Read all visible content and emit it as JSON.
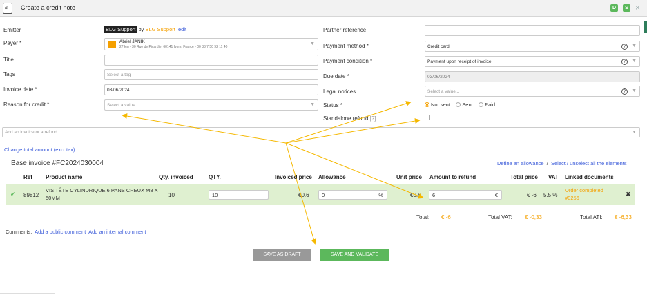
{
  "header": {
    "title": "Create a credit note",
    "badge_d": "D",
    "badge_s": "S",
    "close": "×"
  },
  "left_form": {
    "emitter_label": "Emitter",
    "emitter_tag": "BLG Support",
    "emitter_by": "by",
    "emitter_link": "BLG Support",
    "emitter_edit": "edit",
    "payer_label": "Payer *",
    "payer_name": "Abriel JANIK",
    "payer_address": "27 km - 30 Rue de Picardie, 60141 Ivors; France - 00 33 7 50 92 11 40",
    "title_label": "Title",
    "title_value": "",
    "tags_label": "Tags",
    "tags_placeholder": "Select a tag",
    "invoice_date_label": "Invoice date *",
    "invoice_date_value": "03/06/2024",
    "reason_label": "Reason for credit *",
    "reason_placeholder": "Select a value..."
  },
  "right_form": {
    "partner_ref_label": "Partner reference",
    "partner_ref_value": "",
    "payment_method_label": "Payment method *",
    "payment_method_value": "Credit card",
    "payment_condition_label": "Payment condition *",
    "payment_condition_value": "Payment upon receipt of invoice",
    "due_date_label": "Due date *",
    "due_date_value": "03/06/2024",
    "legal_label": "Legal notices",
    "legal_placeholder": "Select a value...",
    "status_label": "Status *",
    "status_options": [
      "Not sent",
      "Sent",
      "Paid"
    ],
    "status_selected": "Not sent",
    "standalone_label": "Standalone refund",
    "standalone_help": "[?]",
    "standalone_checked": false
  },
  "add_invoice_placeholder": "Add an invoice or a refund",
  "change_total_link": "Change total amount (exc. tax)",
  "base_invoice_title": "Base invoice #FC2024030004",
  "define_allowance_link": "Define an allowance",
  "separator": "/",
  "select_all_link": "Select / unselect all the elements",
  "table": {
    "headers": [
      "Ref",
      "Product name",
      "Qty. invoiced",
      "QTY.",
      "Invoiced price",
      "Allowance",
      "Unit price",
      "Amount to refund",
      "Total price",
      "VAT",
      "Linked documents"
    ],
    "row": {
      "ref": "89812",
      "product_line1": "VIS TÊTE CYLINDRIQUE 6 PANS CREUX M8 X",
      "product_line2": "50MM",
      "qty_invoiced": "10",
      "qty": "10",
      "invoiced_price": "€0.6",
      "allowance": "0",
      "allowance_unit": "%",
      "unit_price": "€0.6",
      "amount_to_refund": "6",
      "amount_unit": "€",
      "total_price": "€ -6",
      "vat": "5.5 %",
      "linked_line1": "Order completed",
      "linked_line2": "#0256",
      "remove": "✖"
    }
  },
  "totals": {
    "total_label": "Total:",
    "total_value": "€ -6",
    "vat_label": "Total VAT:",
    "vat_value": "€ -0,33",
    "ati_label": "Total ATI:",
    "ati_value": "€ -6,33"
  },
  "comments": {
    "label": "Comments:",
    "public": "Add a public comment",
    "internal": "Add an internal comment"
  },
  "buttons": {
    "draft": "SAVE AS DRAFT",
    "validate": "SAVE AND VALIDATE"
  },
  "colors": {
    "accent": "#f5a000",
    "link": "#3b5bd9",
    "success": "#5cb85c",
    "row_highlight": "#dff0d0",
    "draft_button": "#999999"
  }
}
